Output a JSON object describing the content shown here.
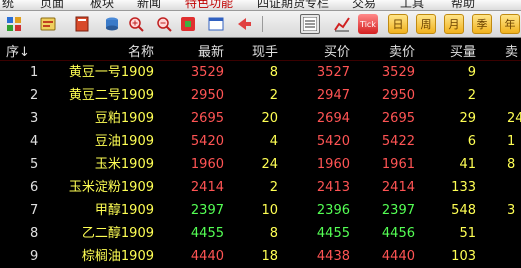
{
  "menu": [
    "统",
    "页面",
    "板块",
    "新闻",
    "特色功能",
    "四证期货专栏",
    "交易",
    "工具",
    "帮助"
  ],
  "menu_active_index": 4,
  "toolbar": {
    "icons": [
      "tiles-icon",
      "card-icon",
      "book-icon",
      "database-icon",
      "zoom-in-icon",
      "zoom-out-icon",
      "refresh-icon",
      "window-icon",
      "arrow-left-icon",
      "list-icon",
      "line-chart-icon",
      "tick-icon"
    ],
    "tick_label": "Tick",
    "periods": [
      "日",
      "周",
      "月",
      "季",
      "年"
    ]
  },
  "columns": [
    "序↓",
    "名称",
    "最新",
    "现手",
    "买价",
    "卖价",
    "买量",
    "卖"
  ],
  "rows": [
    {
      "idx": "1",
      "name": "黄豆一号1909",
      "last": "3529",
      "vol": "8",
      "bid": "3527",
      "ask": "3529",
      "bidvol": "9",
      "askvol": "",
      "color": "red"
    },
    {
      "idx": "2",
      "name": "黄豆二号1909",
      "last": "2950",
      "vol": "2",
      "bid": "2947",
      "ask": "2950",
      "bidvol": "2",
      "askvol": "",
      "color": "red"
    },
    {
      "idx": "3",
      "name": "豆粕1909",
      "last": "2695",
      "vol": "20",
      "bid": "2694",
      "ask": "2695",
      "bidvol": "29",
      "askvol": "24",
      "color": "red"
    },
    {
      "idx": "4",
      "name": "豆油1909",
      "last": "5420",
      "vol": "4",
      "bid": "5420",
      "ask": "5422",
      "bidvol": "6",
      "askvol": "1",
      "color": "red"
    },
    {
      "idx": "5",
      "name": "玉米1909",
      "last": "1960",
      "vol": "24",
      "bid": "1960",
      "ask": "1961",
      "bidvol": "41",
      "askvol": "8",
      "color": "red"
    },
    {
      "idx": "6",
      "name": "玉米淀粉1909",
      "last": "2414",
      "vol": "2",
      "bid": "2413",
      "ask": "2414",
      "bidvol": "133",
      "askvol": "",
      "color": "red"
    },
    {
      "idx": "7",
      "name": "甲醇1909",
      "last": "2397",
      "vol": "10",
      "bid": "2396",
      "ask": "2397",
      "bidvol": "548",
      "askvol": "3",
      "color": "green"
    },
    {
      "idx": "8",
      "name": "乙二醇1909",
      "last": "4455",
      "vol": "8",
      "bid": "4455",
      "ask": "4456",
      "bidvol": "51",
      "askvol": "",
      "color": "green"
    },
    {
      "idx": "9",
      "name": "棕榈油1909",
      "last": "4440",
      "vol": "18",
      "bid": "4438",
      "ask": "4440",
      "bidvol": "103",
      "askvol": "",
      "color": "red"
    }
  ]
}
